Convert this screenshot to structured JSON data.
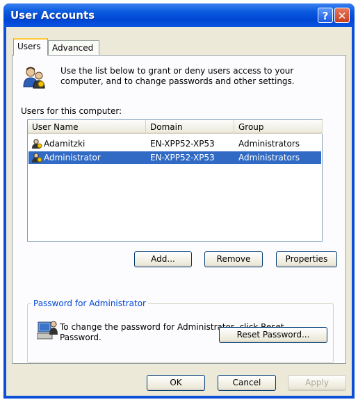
{
  "window": {
    "title": "User Accounts",
    "help_glyph": "?",
    "close_glyph": "✕"
  },
  "tabs": [
    {
      "label": "Users"
    },
    {
      "label": "Advanced"
    }
  ],
  "intro": "Use the list below to grant or deny users access to your computer, and to change passwords and other settings.",
  "list": {
    "label": "Users for this computer:",
    "columns": [
      "User Name",
      "Domain",
      "Group"
    ],
    "rows": [
      {
        "user": "Adamitzki",
        "domain": "EN-XPP52-XP53",
        "group": "Administrators"
      },
      {
        "user": "Administrator",
        "domain": "EN-XPP52-XP53",
        "group": "Administrators"
      }
    ],
    "selected_index": 1
  },
  "list_buttons": {
    "add": "Add...",
    "remove": "Remove",
    "properties": "Properties"
  },
  "password_group": {
    "label": "Password for Administrator",
    "text": "To change the password for Administrator, click Reset Password.",
    "reset_button": "Reset Password..."
  },
  "dialog_buttons": {
    "ok": "OK",
    "cancel": "Cancel",
    "apply": "Apply"
  },
  "icons": {
    "users": "users-icon",
    "computer": "computer-user-icon",
    "user_row": "user-icon"
  },
  "colors": {
    "titlebar": "#0a4fd6",
    "selection": "#316ac5",
    "tab_highlight": "#ffc83c",
    "group_label": "#0046d5"
  }
}
